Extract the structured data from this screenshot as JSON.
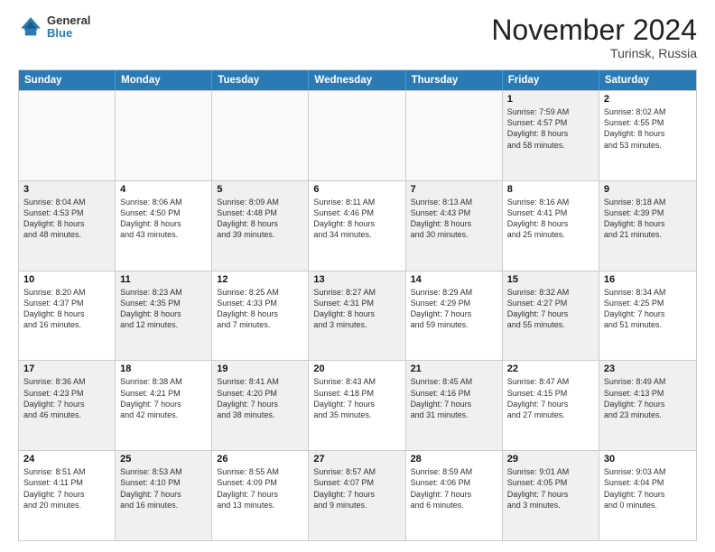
{
  "header": {
    "logo": {
      "general": "General",
      "blue": "Blue"
    },
    "title": "November 2024",
    "subtitle": "Turinsk, Russia"
  },
  "days_of_week": [
    "Sunday",
    "Monday",
    "Tuesday",
    "Wednesday",
    "Thursday",
    "Friday",
    "Saturday"
  ],
  "weeks": [
    [
      {
        "day": "",
        "info": "",
        "shaded": false,
        "empty": true
      },
      {
        "day": "",
        "info": "",
        "shaded": false,
        "empty": true
      },
      {
        "day": "",
        "info": "",
        "shaded": false,
        "empty": true
      },
      {
        "day": "",
        "info": "",
        "shaded": false,
        "empty": true
      },
      {
        "day": "",
        "info": "",
        "shaded": false,
        "empty": true
      },
      {
        "day": "1",
        "info": "Sunrise: 7:59 AM\nSunset: 4:57 PM\nDaylight: 8 hours\nand 58 minutes.",
        "shaded": true,
        "empty": false
      },
      {
        "day": "2",
        "info": "Sunrise: 8:02 AM\nSunset: 4:55 PM\nDaylight: 8 hours\nand 53 minutes.",
        "shaded": false,
        "empty": false
      }
    ],
    [
      {
        "day": "3",
        "info": "Sunrise: 8:04 AM\nSunset: 4:53 PM\nDaylight: 8 hours\nand 48 minutes.",
        "shaded": true,
        "empty": false
      },
      {
        "day": "4",
        "info": "Sunrise: 8:06 AM\nSunset: 4:50 PM\nDaylight: 8 hours\nand 43 minutes.",
        "shaded": false,
        "empty": false
      },
      {
        "day": "5",
        "info": "Sunrise: 8:09 AM\nSunset: 4:48 PM\nDaylight: 8 hours\nand 39 minutes.",
        "shaded": true,
        "empty": false
      },
      {
        "day": "6",
        "info": "Sunrise: 8:11 AM\nSunset: 4:46 PM\nDaylight: 8 hours\nand 34 minutes.",
        "shaded": false,
        "empty": false
      },
      {
        "day": "7",
        "info": "Sunrise: 8:13 AM\nSunset: 4:43 PM\nDaylight: 8 hours\nand 30 minutes.",
        "shaded": true,
        "empty": false
      },
      {
        "day": "8",
        "info": "Sunrise: 8:16 AM\nSunset: 4:41 PM\nDaylight: 8 hours\nand 25 minutes.",
        "shaded": false,
        "empty": false
      },
      {
        "day": "9",
        "info": "Sunrise: 8:18 AM\nSunset: 4:39 PM\nDaylight: 8 hours\nand 21 minutes.",
        "shaded": true,
        "empty": false
      }
    ],
    [
      {
        "day": "10",
        "info": "Sunrise: 8:20 AM\nSunset: 4:37 PM\nDaylight: 8 hours\nand 16 minutes.",
        "shaded": false,
        "empty": false
      },
      {
        "day": "11",
        "info": "Sunrise: 8:23 AM\nSunset: 4:35 PM\nDaylight: 8 hours\nand 12 minutes.",
        "shaded": true,
        "empty": false
      },
      {
        "day": "12",
        "info": "Sunrise: 8:25 AM\nSunset: 4:33 PM\nDaylight: 8 hours\nand 7 minutes.",
        "shaded": false,
        "empty": false
      },
      {
        "day": "13",
        "info": "Sunrise: 8:27 AM\nSunset: 4:31 PM\nDaylight: 8 hours\nand 3 minutes.",
        "shaded": true,
        "empty": false
      },
      {
        "day": "14",
        "info": "Sunrise: 8:29 AM\nSunset: 4:29 PM\nDaylight: 7 hours\nand 59 minutes.",
        "shaded": false,
        "empty": false
      },
      {
        "day": "15",
        "info": "Sunrise: 8:32 AM\nSunset: 4:27 PM\nDaylight: 7 hours\nand 55 minutes.",
        "shaded": true,
        "empty": false
      },
      {
        "day": "16",
        "info": "Sunrise: 8:34 AM\nSunset: 4:25 PM\nDaylight: 7 hours\nand 51 minutes.",
        "shaded": false,
        "empty": false
      }
    ],
    [
      {
        "day": "17",
        "info": "Sunrise: 8:36 AM\nSunset: 4:23 PM\nDaylight: 7 hours\nand 46 minutes.",
        "shaded": true,
        "empty": false
      },
      {
        "day": "18",
        "info": "Sunrise: 8:38 AM\nSunset: 4:21 PM\nDaylight: 7 hours\nand 42 minutes.",
        "shaded": false,
        "empty": false
      },
      {
        "day": "19",
        "info": "Sunrise: 8:41 AM\nSunset: 4:20 PM\nDaylight: 7 hours\nand 38 minutes.",
        "shaded": true,
        "empty": false
      },
      {
        "day": "20",
        "info": "Sunrise: 8:43 AM\nSunset: 4:18 PM\nDaylight: 7 hours\nand 35 minutes.",
        "shaded": false,
        "empty": false
      },
      {
        "day": "21",
        "info": "Sunrise: 8:45 AM\nSunset: 4:16 PM\nDaylight: 7 hours\nand 31 minutes.",
        "shaded": true,
        "empty": false
      },
      {
        "day": "22",
        "info": "Sunrise: 8:47 AM\nSunset: 4:15 PM\nDaylight: 7 hours\nand 27 minutes.",
        "shaded": false,
        "empty": false
      },
      {
        "day": "23",
        "info": "Sunrise: 8:49 AM\nSunset: 4:13 PM\nDaylight: 7 hours\nand 23 minutes.",
        "shaded": true,
        "empty": false
      }
    ],
    [
      {
        "day": "24",
        "info": "Sunrise: 8:51 AM\nSunset: 4:11 PM\nDaylight: 7 hours\nand 20 minutes.",
        "shaded": false,
        "empty": false
      },
      {
        "day": "25",
        "info": "Sunrise: 8:53 AM\nSunset: 4:10 PM\nDaylight: 7 hours\nand 16 minutes.",
        "shaded": true,
        "empty": false
      },
      {
        "day": "26",
        "info": "Sunrise: 8:55 AM\nSunset: 4:09 PM\nDaylight: 7 hours\nand 13 minutes.",
        "shaded": false,
        "empty": false
      },
      {
        "day": "27",
        "info": "Sunrise: 8:57 AM\nSunset: 4:07 PM\nDaylight: 7 hours\nand 9 minutes.",
        "shaded": true,
        "empty": false
      },
      {
        "day": "28",
        "info": "Sunrise: 8:59 AM\nSunset: 4:06 PM\nDaylight: 7 hours\nand 6 minutes.",
        "shaded": false,
        "empty": false
      },
      {
        "day": "29",
        "info": "Sunrise: 9:01 AM\nSunset: 4:05 PM\nDaylight: 7 hours\nand 3 minutes.",
        "shaded": true,
        "empty": false
      },
      {
        "day": "30",
        "info": "Sunrise: 9:03 AM\nSunset: 4:04 PM\nDaylight: 7 hours\nand 0 minutes.",
        "shaded": false,
        "empty": false
      }
    ]
  ]
}
